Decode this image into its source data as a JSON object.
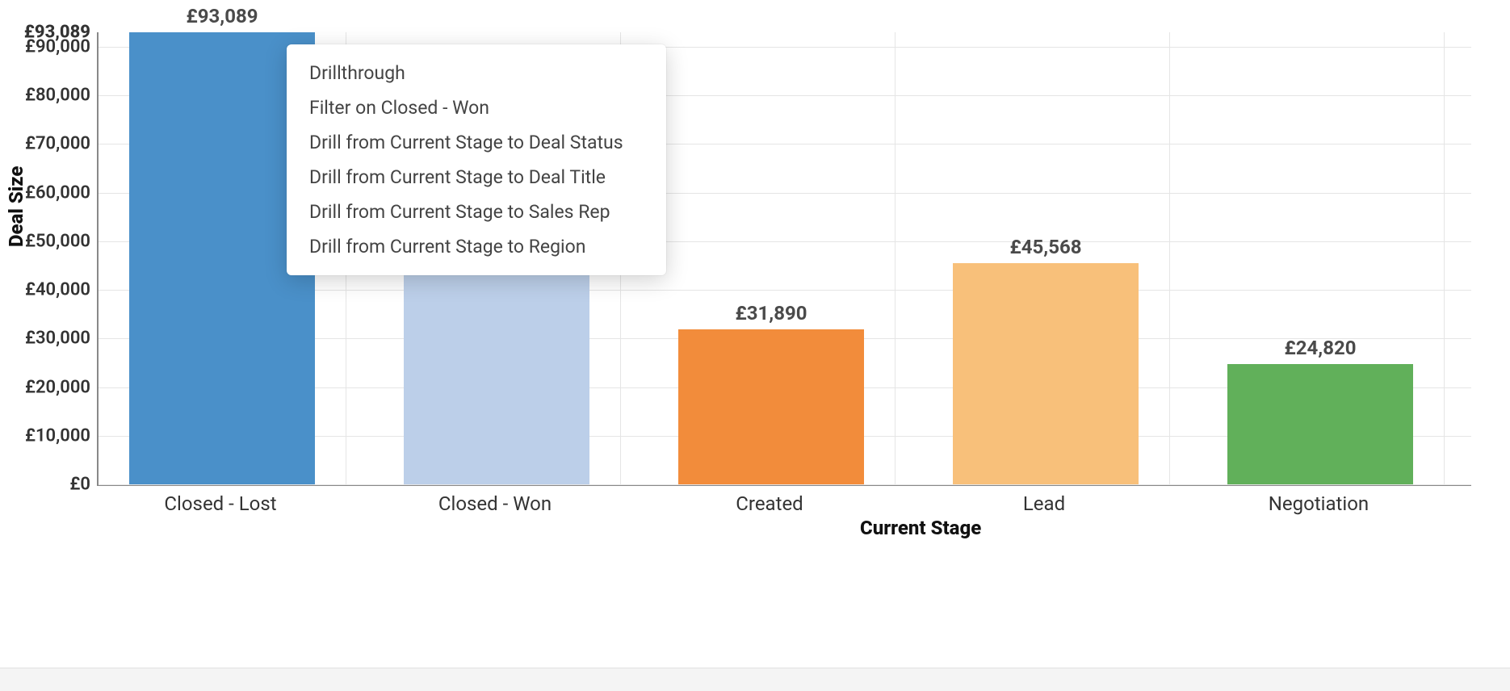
{
  "chart_data": {
    "type": "bar",
    "categories": [
      "Closed - Lost",
      "Closed - Won",
      "Created",
      "Lead",
      "Negotiation"
    ],
    "values": [
      93089,
      45000,
      31890,
      45568,
      24820
    ],
    "value_labels": [
      "£93,089",
      "",
      "£31,890",
      "£45,568",
      "£24,820"
    ],
    "colors": [
      "#4a90c9",
      "#bccfe9",
      "#f28c3b",
      "#f8c07a",
      "#61b05a"
    ],
    "title": "",
    "xlabel": "Current Stage",
    "ylabel": "Deal Size",
    "ylim": [
      0,
      93000
    ],
    "y_ticks": [
      0,
      10000,
      20000,
      30000,
      40000,
      50000,
      60000,
      70000,
      80000,
      90000
    ],
    "y_tick_labels": [
      "£0",
      "£10,000",
      "£20,000",
      "£30,000",
      "£40,000",
      "£50,000",
      "£60,000",
      "£70,000",
      "£80,000",
      "£90,000"
    ],
    "y_max_label": "£93,089"
  },
  "context_menu": {
    "position_category_index": 1,
    "items": [
      "Drillthrough",
      "Filter on Closed - Won",
      "Drill from Current Stage to Deal Status",
      "Drill from Current Stage to Deal Title",
      "Drill from Current Stage to Sales Rep",
      "Drill from Current Stage to Region"
    ]
  }
}
